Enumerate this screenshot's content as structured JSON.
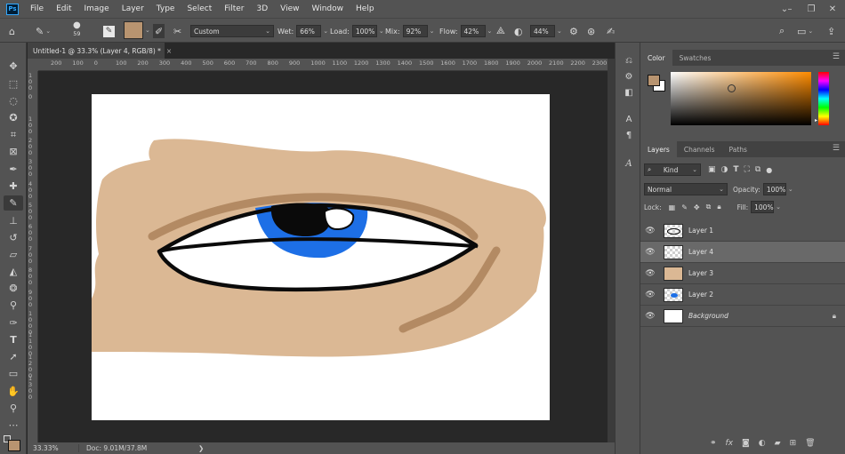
{
  "app": {
    "logo": "Ps"
  },
  "menu": [
    "File",
    "Edit",
    "Image",
    "Layer",
    "Type",
    "Select",
    "Filter",
    "3D",
    "View",
    "Window",
    "Help"
  ],
  "window_controls": [
    "⌄",
    "–",
    "❐",
    "✕"
  ],
  "options": {
    "brush_size": "59",
    "color_swatch": "#b89470",
    "preset": "Custom",
    "wet_label": "Wet:",
    "wet": "66%",
    "load_label": "Load:",
    "load": "100%",
    "mix_label": "Mix:",
    "mix": "92%",
    "flow_label": "Flow:",
    "flow": "42%",
    "angle": "44%"
  },
  "document": {
    "tab_title": "Untitled-1 @ 33.3% (Layer 4, RGB/8) *",
    "close": "×"
  },
  "ruler_h": [
    "200",
    "100",
    "0",
    "100",
    "200",
    "300",
    "400",
    "500",
    "600",
    "700",
    "800",
    "900",
    "1000",
    "1100",
    "1200",
    "1300",
    "1400",
    "1500",
    "1600",
    "1700",
    "1800",
    "1900",
    "2000",
    "2100",
    "2200",
    "2300"
  ],
  "ruler_v": [
    "100",
    "0",
    "100",
    "200",
    "300",
    "400",
    "500",
    "600",
    "700",
    "800",
    "900",
    "1000",
    "1100",
    "1200",
    "1300"
  ],
  "status": {
    "zoom": "33.33%",
    "doc": "Doc: 9.01M/37.8M",
    "arrow": "❯"
  },
  "color_panel": {
    "tabs": [
      "Color",
      "Swatches"
    ],
    "foreground": "#b89470",
    "background": "#ffffff",
    "hue": "#ff8c00"
  },
  "layers_panel": {
    "tabs": [
      "Layers",
      "Channels",
      "Paths"
    ],
    "filter_kind": "Kind",
    "blend_mode": "Normal",
    "opacity_label": "Opacity:",
    "opacity": "100%",
    "lock_label": "Lock:",
    "fill_label": "Fill:",
    "fill": "100%",
    "layers": [
      {
        "name": "Layer 1",
        "selected": false,
        "italic": false,
        "locked": false
      },
      {
        "name": "Layer 4",
        "selected": true,
        "italic": false,
        "locked": false
      },
      {
        "name": "Layer 3",
        "selected": false,
        "italic": false,
        "locked": false
      },
      {
        "name": "Layer 2",
        "selected": false,
        "italic": false,
        "locked": false
      },
      {
        "name": "Background",
        "selected": false,
        "italic": true,
        "locked": true
      }
    ]
  },
  "colors": {
    "skin": "#dbb894",
    "brow": "#b38a63",
    "iris": "#1d6fe6",
    "ui_bg": "#535353"
  }
}
